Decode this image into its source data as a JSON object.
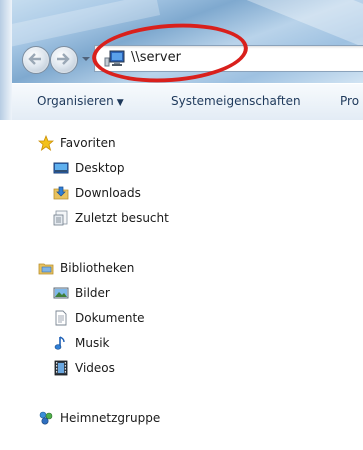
{
  "address_bar": {
    "path": "\\\\server",
    "location_icon": "computer-icon"
  },
  "toolbar": {
    "organize_label": "Organisieren",
    "organize_caret": "▼",
    "system_properties_label": "Systemeigenschaften",
    "more_label": "Pro"
  },
  "nav": {
    "favorites": {
      "label": "Favoriten",
      "icon": "star-icon",
      "items": [
        {
          "label": "Desktop",
          "icon": "desktop-icon"
        },
        {
          "label": "Downloads",
          "icon": "downloads-folder-icon"
        },
        {
          "label": "Zuletzt besucht",
          "icon": "recent-places-icon"
        }
      ]
    },
    "libraries": {
      "label": "Bibliotheken",
      "icon": "libraries-icon",
      "items": [
        {
          "label": "Bilder",
          "icon": "pictures-icon"
        },
        {
          "label": "Dokumente",
          "icon": "documents-icon"
        },
        {
          "label": "Musik",
          "icon": "music-icon"
        },
        {
          "label": "Videos",
          "icon": "videos-icon"
        }
      ]
    },
    "homegroup": {
      "label": "Heimnetzgruppe",
      "icon": "homegroup-icon"
    }
  },
  "colors": {
    "annotation": "#d9201c",
    "toolbar_text": "#1e395b",
    "address_border": "#8aa2bb"
  }
}
